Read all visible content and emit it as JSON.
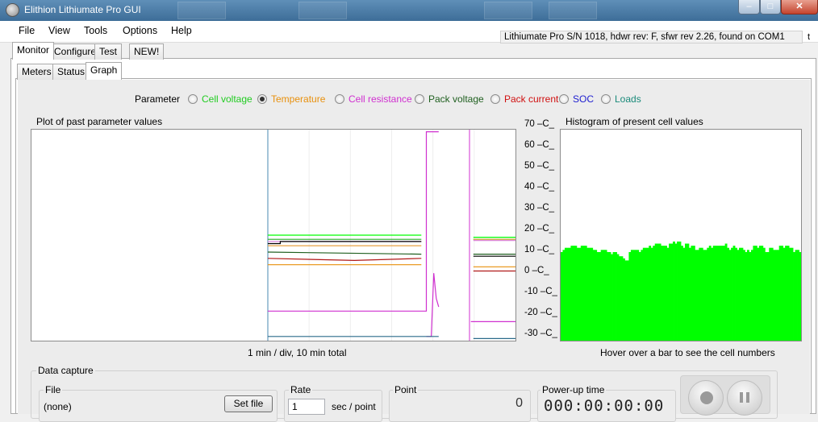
{
  "window": {
    "title": "Elithion Lithiumate Pro GUI",
    "minimize": "–",
    "maximize": "□",
    "close": "✕"
  },
  "menu": [
    "File",
    "View",
    "Tools",
    "Options",
    "Help"
  ],
  "device_info": "Lithiumate Pro S/N 1018, hdwr rev: F, sfwr rev 2.26, found on COM1",
  "trailing_char": "t",
  "top_tabs": [
    "Monitor",
    "Configure",
    "Test",
    "NEW!"
  ],
  "sub_tabs": [
    "Meters",
    "Status",
    "Graph"
  ],
  "parameter": {
    "label": "Parameter",
    "selected": "Temperature",
    "options": [
      {
        "label": "Cell voltage",
        "color": "#22cc22"
      },
      {
        "label": "Temperature",
        "color": "#e8900c"
      },
      {
        "label": "Cell resistance",
        "color": "#d030d0"
      },
      {
        "label": "Pack voltage",
        "color": "#206020"
      },
      {
        "label": "Pack current",
        "color": "#d01010"
      },
      {
        "label": "SOC",
        "color": "#2020d0"
      },
      {
        "label": "Loads",
        "color": "#1a8a7a"
      }
    ]
  },
  "plot": {
    "title": "Plot of past parameter values",
    "footer": "1 min / div, 10 min total"
  },
  "histogram": {
    "title": "Histogram of present cell values",
    "footer": "Hover over a bar to see the cell numbers",
    "bar_color": "#00ff00"
  },
  "chart_data": [
    {
      "type": "bar",
      "title": "Histogram of present cell values",
      "ylabel": "",
      "ylim": [
        -30,
        70
      ],
      "y_ticks": [
        "70 –C_",
        "60 –C_",
        "50 –C_",
        "40 –C_",
        "30 –C_",
        "20 –C_",
        "10 –C_",
        "0 –C_",
        "-10 –C_",
        "-20 –C_",
        "-30 –C_"
      ],
      "values": [
        12,
        13,
        14,
        14,
        14,
        15,
        15,
        15,
        14,
        14,
        15,
        15,
        15,
        14,
        14,
        14,
        13,
        13,
        12,
        12,
        13,
        13,
        13,
        12,
        12,
        11,
        12,
        12,
        11,
        10,
        10,
        9,
        8,
        8,
        12,
        13,
        13,
        13,
        13,
        12,
        13,
        14,
        14,
        14,
        15,
        14,
        15,
        16,
        16,
        16,
        15,
        15,
        15,
        14,
        16,
        16,
        17,
        16,
        17,
        17,
        15,
        14,
        16,
        16,
        14,
        15,
        15,
        13,
        13,
        14,
        14,
        13,
        13,
        14,
        15,
        14,
        15,
        15,
        15,
        15,
        15,
        15,
        16,
        14,
        13,
        14,
        15,
        14,
        13,
        14,
        14,
        13,
        12,
        13,
        12,
        13,
        15,
        15,
        14,
        15,
        15,
        14,
        12,
        12,
        14,
        14,
        13,
        13,
        13,
        15,
        15,
        14,
        15,
        15,
        14,
        14,
        12,
        13,
        13,
        12
      ]
    },
    {
      "type": "line",
      "title": "Plot of past parameter values",
      "xlabel": "1 min / div, 10 min total",
      "ylim": [
        -30,
        70
      ],
      "series": [
        {
          "color": "#00ff00",
          "segments": [
            [
              [
                0.0,
                20
              ],
              [
                0.62,
                20
              ]
            ],
            [
              [
                0.83,
                19
              ],
              [
                1.0,
                19
              ]
            ]
          ]
        },
        {
          "color": "#22aa22",
          "segments": [
            [
              [
                0.0,
                18
              ],
              [
                0.62,
                18
              ]
            ],
            [
              [
                0.83,
                18
              ],
              [
                1.0,
                18
              ]
            ]
          ]
        },
        {
          "color": "#dd88dd",
          "segments": [
            [
              [
                0.0,
                17
              ],
              [
                0.62,
                17
              ]
            ],
            [
              [
                0.83,
                17.5
              ],
              [
                1.0,
                17.5
              ]
            ]
          ]
        },
        {
          "color": "#000000",
          "segments": [
            [
              [
                0.0,
                16
              ],
              [
                0.05,
                16
              ],
              [
                0.05,
                17
              ],
              [
                0.62,
                17
              ]
            ],
            [
              [
                0.83,
                10
              ],
              [
                1.0,
                10
              ]
            ]
          ]
        },
        {
          "color": "#e8a040",
          "segments": [
            [
              [
                0.0,
                15
              ],
              [
                0.62,
                15
              ]
            ],
            [
              [
                0.83,
                18
              ],
              [
                1.0,
                18
              ]
            ]
          ]
        },
        {
          "color": "#206020",
          "segments": [
            [
              [
                0.0,
                12
              ],
              [
                0.62,
                11
              ]
            ],
            [
              [
                0.83,
                11
              ],
              [
                1.0,
                11
              ]
            ]
          ]
        },
        {
          "color": "#b01818",
          "segments": [
            [
              [
                0.0,
                9
              ],
              [
                0.35,
                8
              ],
              [
                0.62,
                9
              ]
            ],
            [
              [
                0.83,
                3
              ],
              [
                1.0,
                3
              ]
            ]
          ]
        },
        {
          "color": "#e8900c",
          "segments": [
            [
              [
                0.0,
                6
              ],
              [
                0.62,
                6
              ]
            ],
            [
              [
                0.83,
                5
              ],
              [
                1.0,
                5
              ]
            ]
          ]
        },
        {
          "color": "#d030d0",
          "segments": [
            [
              [
                0.0,
                -16
              ],
              [
                0.64,
                -16
              ],
              [
                0.64,
                69
              ],
              [
                0.69,
                69
              ]
            ],
            [
              [
                0.64,
                -28
              ],
              [
                0.66,
                -28
              ],
              [
                0.67,
                2
              ],
              [
                0.68,
                -10
              ],
              [
                0.69,
                -14
              ]
            ],
            [
              [
                0.82,
                -21
              ],
              [
                1.0,
                -21
              ]
            ]
          ]
        },
        {
          "color": "#2a6a8a",
          "segments": [
            [
              [
                0.0,
                -28
              ],
              [
                0.69,
                -28
              ]
            ],
            [
              [
                0.83,
                -29
              ],
              [
                1.0,
                -29
              ]
            ]
          ]
        }
      ]
    }
  ],
  "data_capture": {
    "title": "Data capture",
    "file": {
      "label": "File",
      "value": "(none)",
      "button": "Set file"
    },
    "rate": {
      "label": "Rate",
      "value": "1",
      "unit": "sec / point"
    },
    "point": {
      "label": "Point",
      "value": "0"
    },
    "powerup": {
      "label": "Power-up time",
      "value": "000:00:00:00"
    }
  }
}
